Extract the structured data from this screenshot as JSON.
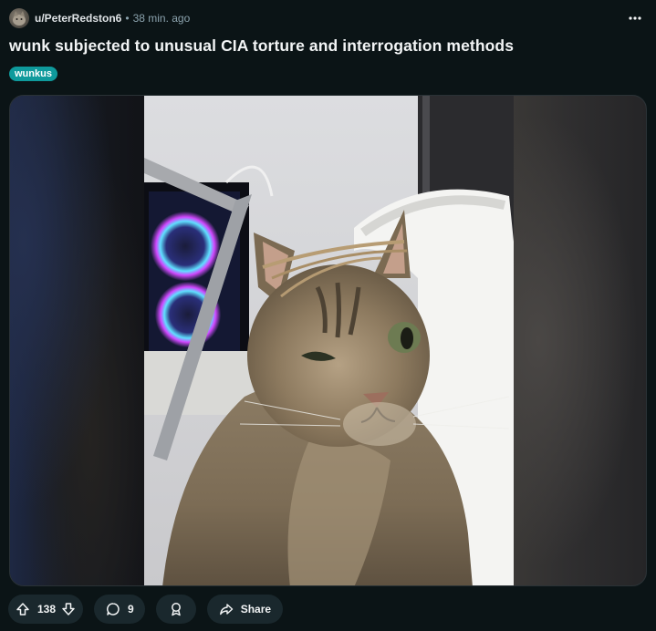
{
  "post": {
    "username": "u/PeterRedston6",
    "separator": "•",
    "time": "38 min. ago",
    "title": "wunk subjected to unusual CIA torture and interrogation methods",
    "flair": "wunkus",
    "flair_color": "#0f9a9c"
  },
  "image": {
    "subject": "tabby cat wearing rubber bands on head in front of gaming PC and white chair"
  },
  "actions": {
    "score": "138",
    "comments": "9",
    "share_label": "Share"
  },
  "icons": {
    "more": "more-horizontal-icon",
    "upvote": "arrow-up-icon",
    "downvote": "arrow-down-icon",
    "comment": "comment-bubble-icon",
    "award": "award-icon",
    "share": "share-arrow-icon"
  },
  "colors": {
    "background": "#0b1416",
    "pill": "#1a282d",
    "muted_text": "#8ba2ad"
  }
}
